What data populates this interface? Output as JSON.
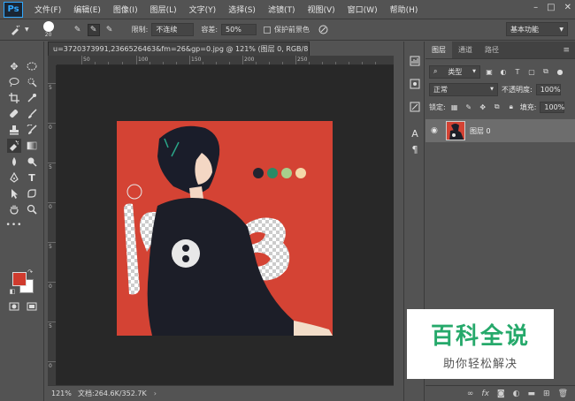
{
  "app": {
    "logo": "Ps"
  },
  "menubar": {
    "items": [
      "文件(F)",
      "编辑(E)",
      "图像(I)",
      "图层(L)",
      "文字(Y)",
      "选择(S)",
      "滤镜(T)",
      "视图(V)",
      "窗口(W)",
      "帮助(H)"
    ],
    "window_controls": [
      "–",
      "□",
      "✕"
    ]
  },
  "options": {
    "brush_size": "20",
    "limit_label": "限制:",
    "limit_value": "不连续",
    "tolerance_label": "容差:",
    "tolerance_value": "50%",
    "protect_label": "保护前景色",
    "workspace": "基本功能"
  },
  "document": {
    "tab_title": "u=3720373991,2366526463&fm=26&gp=0.jpg @ 121% (图层 0, RGB/8#) *",
    "ruler_labels_h": [
      "50",
      "100",
      "150",
      "200",
      "250"
    ],
    "ruler_labels_v": [
      "5",
      "0",
      "5",
      "0",
      "5",
      "0",
      "5",
      "0"
    ]
  },
  "status": {
    "zoom": "121%",
    "doc_size": "文档:264.6K/352.7K"
  },
  "layers_panel": {
    "tabs": [
      "图层",
      "通道",
      "路径"
    ],
    "filter_kind": "类型",
    "blend_mode": "正常",
    "opacity_label": "不透明度:",
    "opacity_value": "100%",
    "lock_label": "锁定:",
    "fill_label": "填充:",
    "fill_value": "100%",
    "layers": [
      {
        "name": "图层 0"
      }
    ]
  },
  "watermark": {
    "title": "百科全说",
    "subtitle": "助你轻松解决"
  },
  "colors": {
    "foreground": "#d03b2e",
    "background": "#ffffff",
    "accent": "#31a8ff",
    "watermark_green": "#26a96b"
  },
  "icons": {
    "toolbar": [
      "move-icon",
      "marquee-icon",
      "lasso-icon",
      "quick-select-icon",
      "crop-icon",
      "eyedropper-icon",
      "healing-icon",
      "brush-icon",
      "stamp-icon",
      "history-brush-icon",
      "magic-eraser-icon",
      "gradient-icon",
      "blur-icon",
      "dodge-icon",
      "pen-icon",
      "type-icon",
      "path-select-icon",
      "shape-icon",
      "hand-icon",
      "zoom-icon",
      "more-icon"
    ]
  }
}
